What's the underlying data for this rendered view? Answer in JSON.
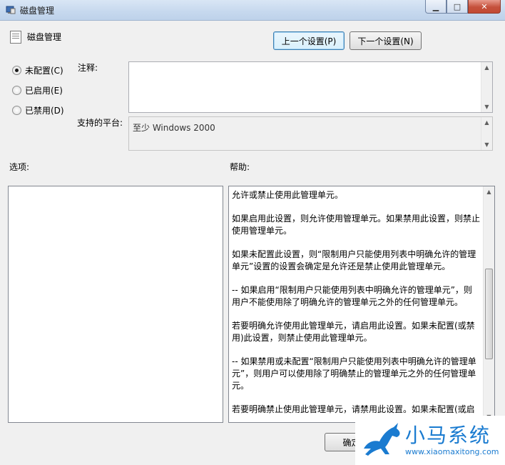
{
  "window": {
    "title": "磁盘管理",
    "controls": {
      "minimize": "▁",
      "maximize": "□",
      "close": "✕"
    }
  },
  "setting_name": "磁盘管理",
  "buttons": {
    "previous": "上一个设置(P)",
    "next": "下一个设置(N)",
    "ok": "确定"
  },
  "state": {
    "options": [
      {
        "label": "未配置(C)",
        "selected": true
      },
      {
        "label": "已启用(E)",
        "selected": false
      },
      {
        "label": "已禁用(D)",
        "selected": false
      }
    ]
  },
  "comment": {
    "label": "注释:",
    "value": ""
  },
  "platform": {
    "label": "支持的平台:",
    "value": "至少 Windows 2000"
  },
  "options_label": "选项:",
  "help": {
    "label": "帮助:",
    "paragraphs": [
      "允许或禁止使用此管理单元。",
      "如果启用此设置，则允许使用管理单元。如果禁用此设置，则禁止使用管理单元。",
      "如果未配置此设置，则“限制用户只能使用列表中明确允许的管理单元”设置的设置会确定是允许还是禁止使用此管理单元。",
      "-- 如果启用“限制用户只能使用列表中明确允许的管理单元”，则用户不能使用除了明确允许的管理单元之外的任何管理单元。",
      "若要明确允许使用此管理单元，请启用此设置。如果未配置(或禁用)此设置，则禁止使用此管理单元。",
      "-- 如果禁用或未配置“限制用户只能使用列表中明确允许的管理单元”，则用户可以使用除了明确禁止的管理单元之外的任何管理单元。",
      "若要明确禁止使用此管理单元，请禁用此设置。如果未配置(或启"
    ]
  },
  "watermark": {
    "name": "小马系统",
    "url": "www.xiaomaxitong.com"
  }
}
